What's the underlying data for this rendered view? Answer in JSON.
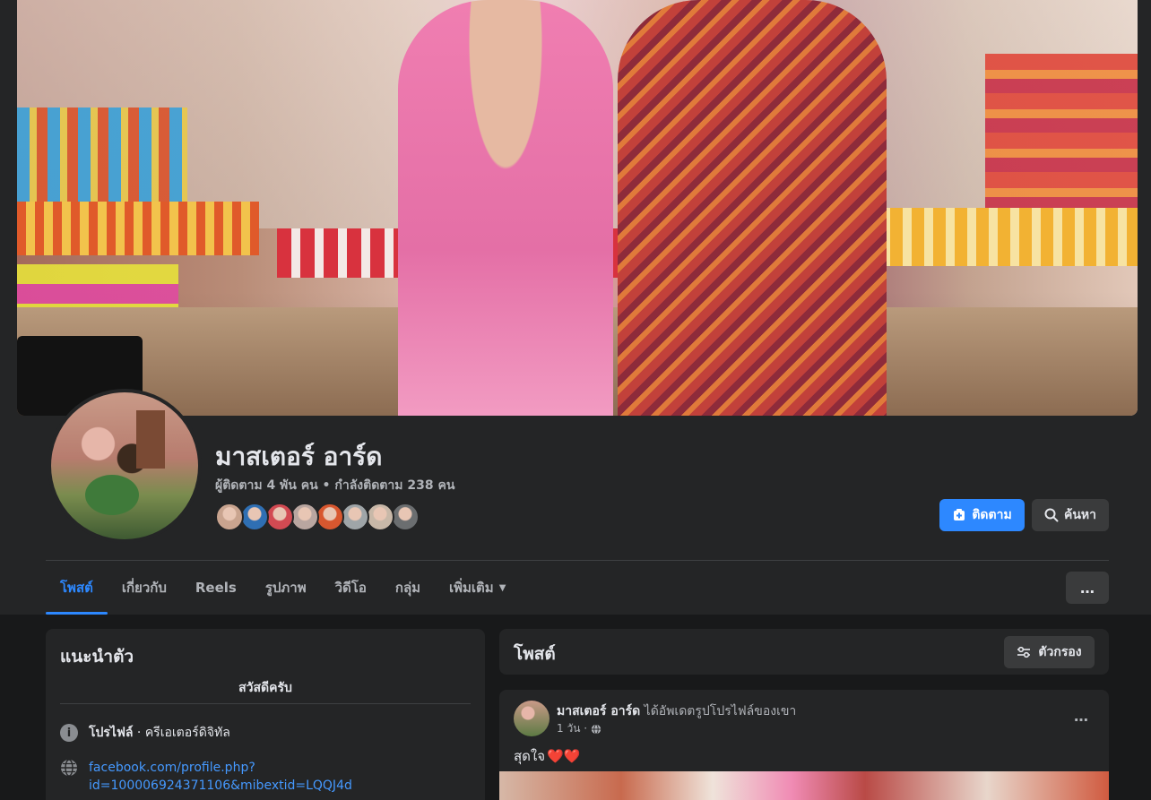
{
  "page": {
    "name": "มาสเตอร์ อาร์ด",
    "stats": "ผู้ติดตาม 4 พัน คน • กำลังติดตาม 238 คน"
  },
  "actions": {
    "follow_label": "ติดตาม",
    "search_label": "ค้นหา",
    "more_icon": "…"
  },
  "friend_avatars": [
    {
      "color": "#c9a48f"
    },
    {
      "color": "#2f6fb3"
    },
    {
      "color": "#d24a52"
    },
    {
      "color": "#b9a6a0"
    },
    {
      "color": "#d8572f"
    },
    {
      "color": "#9fa5a8"
    },
    {
      "color": "#c8b8a8"
    },
    {
      "color": "#6b6e70"
    }
  ],
  "tabs": [
    {
      "label": "โพสต์",
      "active": true
    },
    {
      "label": "เกี่ยวกับ"
    },
    {
      "label": "Reels"
    },
    {
      "label": "รูปภาพ"
    },
    {
      "label": "วิดีโอ"
    },
    {
      "label": "กลุ่ม"
    },
    {
      "label": "เพิ่มเติม",
      "dropdown": true
    }
  ],
  "intro": {
    "title": "แนะนำตัว",
    "bio": "สวัสดีครับ",
    "profile_label": "โปรไฟล์",
    "profile_category": " · ครีเอเตอร์ดิจิทัล",
    "link_line1": "facebook.com/profile.php?",
    "link_line2": "id=100006924371106&mibextid=LQQJ4d"
  },
  "posts": {
    "title": "โพสต์",
    "filter_label": "ตัวกรอง"
  },
  "post": {
    "author": "มาสเตอร์ อาร์ด",
    "action": " ได้อัพเดตรูปโปรไฟล์ของเขา",
    "time": "1 วัน ·",
    "text": "สุดใจ",
    "hearts": "❤️❤️"
  },
  "colors": {
    "accent": "#2d88ff",
    "background": "#18191a",
    "card": "#242526"
  }
}
